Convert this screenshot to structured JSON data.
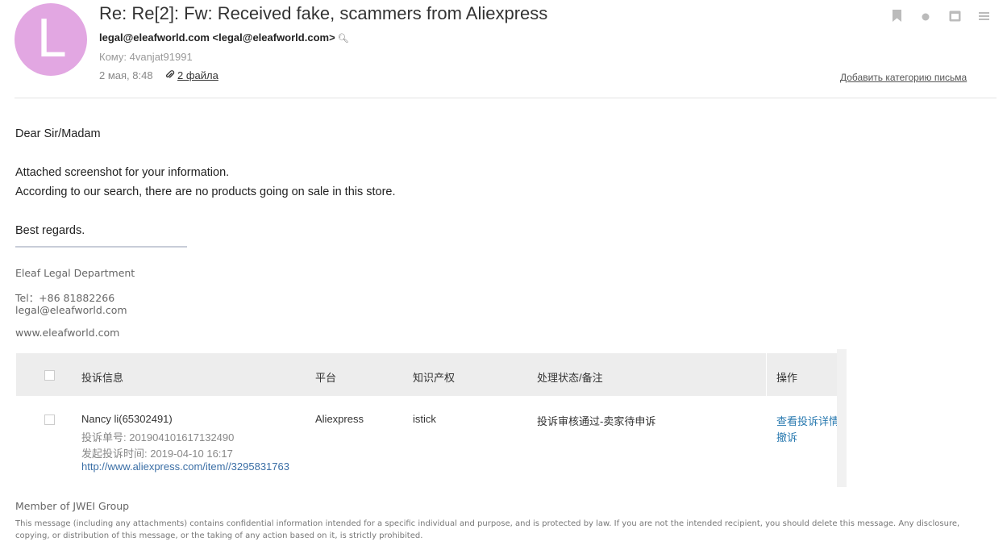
{
  "email": {
    "avatar_letter": "L",
    "subject": "Re: Re[2]: Fw: Received fake, scammers from Aliexpress",
    "from": "legal@eleafworld.com <legal@eleafworld.com>",
    "to": "Кому: 4vanjat91991",
    "date": "2 мая, 8:48",
    "attachments": "2 файла",
    "add_category": "Добавить категорию письма"
  },
  "body": {
    "greeting": "Dear Sir/Madam",
    "line1": "Attached screenshot for your information.",
    "line2": "According to our search, there are no products going on sale in this store.",
    "closing": "Best regards."
  },
  "signature": {
    "department": "Eleaf Legal Department",
    "tel": "Tel：+86 81882266",
    "email": "legal@eleafworld.com",
    "website": "www.eleafworld.com",
    "member": "Member of JWEI Group",
    "disclaimer": "This message (including any attachments) contains confidential information intended for a specific individual and purpose, and is protected by law. If you are not the intended recipient, you should delete this message. Any disclosure, copying, or distribution of this message, or the taking of any action based on it, is strictly prohibited."
  },
  "table": {
    "headers": [
      "投诉信息",
      "平台",
      "知识产权",
      "处理状态/备注",
      "操作"
    ],
    "row": {
      "name": "Nancy li(65302491)",
      "complaint_no": "投诉单号: 201904101617132490",
      "start_time": "发起投诉时间: 2019-04-10 16:17",
      "url": "http://www.aliexpress.com/item//3295831763",
      "platform": "Aliexpress",
      "ip": "istick",
      "status": "投诉审核通过-卖家待申诉",
      "actions": [
        "查看投诉详情",
        "撤诉"
      ]
    }
  },
  "colors": {
    "avatar": "#e2a7e2",
    "link": "#2a7ab0",
    "header_bg": "#ededed"
  },
  "icons": [
    "bookmark-icon",
    "dot-icon",
    "calendar-icon",
    "menu-icon",
    "search-icon",
    "paperclip-icon"
  ]
}
